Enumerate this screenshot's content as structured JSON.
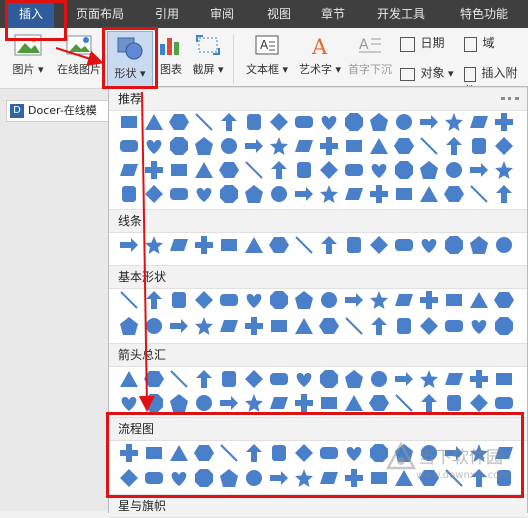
{
  "menubar": {
    "tabs": [
      {
        "label": "插入",
        "active": true
      },
      {
        "label": "页面布局"
      },
      {
        "label": "引用"
      },
      {
        "label": "审阅"
      },
      {
        "label": "视图"
      },
      {
        "label": "章节"
      },
      {
        "label": "开发工具"
      },
      {
        "label": "特色功能"
      }
    ]
  },
  "ribbon": {
    "picture": "图片",
    "online_picture": "在线图片",
    "shapes": "形状",
    "chart": "图表",
    "screenshot": "截屏",
    "textbox": "文本框",
    "wordart": "艺术字",
    "dropcap": "首字下沉",
    "date": "日期",
    "field": "域",
    "object": "对象",
    "insert_attachment": "插入附件"
  },
  "document_tab": {
    "label": "Docer-在线模"
  },
  "shapes_panel": {
    "sections": [
      {
        "title": "推荐"
      },
      {
        "title": "线条"
      },
      {
        "title": "基本形状"
      },
      {
        "title": "箭头总汇"
      },
      {
        "title": "流程图"
      },
      {
        "title": "星与旗帜"
      }
    ]
  },
  "watermark": {
    "text": "当下软件园",
    "url": "www.downxia.com"
  },
  "colors": {
    "shape_fill": "#4a7fc9",
    "highlight": "#e21111",
    "menubar": "#3f3f3f",
    "active_tab": "#2f5c9a"
  }
}
